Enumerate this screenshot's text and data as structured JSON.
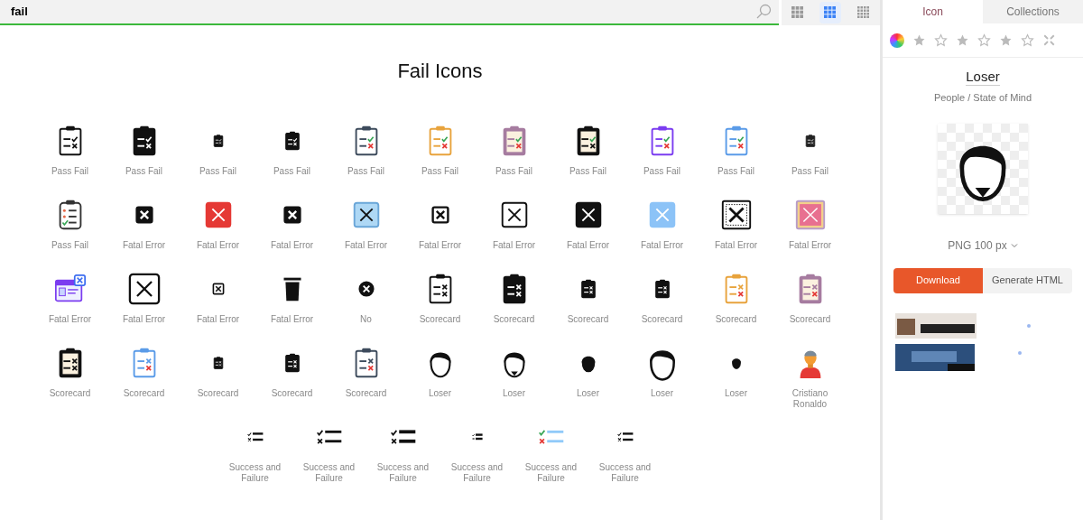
{
  "search": {
    "value": "fail"
  },
  "view_modes": [
    {
      "selected": false
    },
    {
      "selected": true
    },
    {
      "selected": false
    }
  ],
  "title": "Fail Icons",
  "icons": [
    {
      "label": "Pass Fail",
      "kind": "clipboard",
      "color": "#111111"
    },
    {
      "label": "Pass Fail",
      "kind": "clipboard-solid",
      "color": "#111111"
    },
    {
      "label": "Pass Fail",
      "kind": "clipboard-tiny",
      "color": "#111111"
    },
    {
      "label": "Pass Fail",
      "kind": "clipboard-small",
      "color": "#111111"
    },
    {
      "label": "Pass Fail",
      "kind": "clipboard",
      "color": "#3d4b5c"
    },
    {
      "label": "Pass Fail",
      "kind": "clipboard",
      "color": "#e8a33c"
    },
    {
      "label": "Pass Fail",
      "kind": "clipboard-paper",
      "color": "#a67ca0"
    },
    {
      "label": "Pass Fail",
      "kind": "clipboard-paper",
      "color": "#111111"
    },
    {
      "label": "Pass Fail",
      "kind": "clipboard",
      "color": "#7b3cf0"
    },
    {
      "label": "Pass Fail",
      "kind": "clipboard",
      "color": "#5a9be8"
    },
    {
      "label": "Pass Fail",
      "kind": "clipboard-tiny",
      "color": "#222222"
    },
    {
      "label": "Pass Fail",
      "kind": "checklist",
      "color": "#333333"
    },
    {
      "label": "Fatal Error",
      "kind": "xbox-solid-small",
      "color": "#111111"
    },
    {
      "label": "Fatal Error",
      "kind": "xbox-solid",
      "color": "#e53935"
    },
    {
      "label": "Fatal Error",
      "kind": "xbox-solid-small",
      "color": "#111111"
    },
    {
      "label": "Fatal Error",
      "kind": "xbox-light",
      "color": "#aed8f5"
    },
    {
      "label": "Fatal Error",
      "kind": "xbox-small",
      "color": "#111111"
    },
    {
      "label": "Fatal Error",
      "kind": "xbox",
      "color": "#111111"
    },
    {
      "label": "Fatal Error",
      "kind": "xbox-solid",
      "color": "#111111"
    },
    {
      "label": "Fatal Error",
      "kind": "xbox-solid",
      "color": "#8cc3f7"
    },
    {
      "label": "Fatal Error",
      "kind": "xbox-dotted",
      "color": "#111111"
    },
    {
      "label": "Fatal Error",
      "kind": "xbox-framed",
      "color": "#e87090"
    },
    {
      "label": "Fatal Error",
      "kind": "browser-error",
      "color": "#7b3cf0"
    },
    {
      "label": "Fatal Error",
      "kind": "xbox-large",
      "color": "#111111"
    },
    {
      "label": "Fatal Error",
      "kind": "xbox-tiny",
      "color": "#111111"
    },
    {
      "label": "Fatal Error",
      "kind": "trash",
      "color": "#111111"
    },
    {
      "label": "No",
      "kind": "no-dot",
      "color": "#111111"
    },
    {
      "label": "Scorecard",
      "kind": "scorecard",
      "color": "#111111"
    },
    {
      "label": "Scorecard",
      "kind": "scorecard-solid",
      "color": "#111111"
    },
    {
      "label": "Scorecard",
      "kind": "scorecard-small",
      "color": "#111111"
    },
    {
      "label": "Scorecard",
      "kind": "scorecard-small",
      "color": "#111111"
    },
    {
      "label": "Scorecard",
      "kind": "scorecard",
      "color": "#e8a33c"
    },
    {
      "label": "Scorecard",
      "kind": "scorecard-paper",
      "color": "#a67ca0"
    },
    {
      "label": "Scorecard",
      "kind": "scorecard-paper",
      "color": "#111111"
    },
    {
      "label": "Scorecard",
      "kind": "scorecard",
      "color": "#5a9be8"
    },
    {
      "label": "Scorecard",
      "kind": "scorecard-tiny",
      "color": "#111111"
    },
    {
      "label": "Scorecard",
      "kind": "scorecard-small",
      "color": "#111111"
    },
    {
      "label": "Scorecard",
      "kind": "scorecard",
      "color": "#3d4b5c"
    },
    {
      "label": "Loser",
      "kind": "head",
      "color": "#111111"
    },
    {
      "label": "Loser",
      "kind": "head-solid",
      "color": "#111111"
    },
    {
      "label": "Loser",
      "kind": "head-small",
      "color": "#111111"
    },
    {
      "label": "Loser",
      "kind": "head-large",
      "color": "#111111"
    },
    {
      "label": "Loser",
      "kind": "head-tiny",
      "color": "#111111"
    },
    {
      "label": "Cristiano Ronaldo",
      "kind": "person",
      "color": "#e53935"
    },
    {
      "label": "Success and Failure",
      "kind": "list-small",
      "color": "#111111"
    },
    {
      "label": "Success and Failure",
      "kind": "list",
      "color": "#111111"
    },
    {
      "label": "Success and Failure",
      "kind": "list-bold",
      "color": "#111111"
    },
    {
      "label": "Success and Failure",
      "kind": "list-tiny",
      "color": "#111111"
    },
    {
      "label": "Success and Failure",
      "kind": "list",
      "color": "#90caf9"
    },
    {
      "label": "Success and Failure",
      "kind": "list-small",
      "color": "#111111"
    }
  ],
  "panel": {
    "tabs": [
      {
        "label": "Icon",
        "selected": true
      },
      {
        "label": "Collections",
        "selected": false
      }
    ],
    "icon_name": "Loser",
    "category": "People / State of Mind",
    "format": "PNG 100 px",
    "buttons": [
      "Download",
      "Generate HTML"
    ],
    "related": {
      "kind": "picture"
    }
  }
}
